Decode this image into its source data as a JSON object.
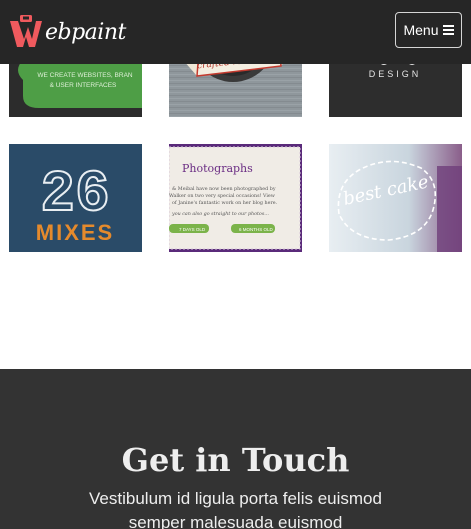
{
  "brand": {
    "logo_text": "ebpaint",
    "accent": "#f05a5e"
  },
  "header": {
    "menu_label": "Menu",
    "menu_icon": "bars-icon",
    "background": "#262626"
  },
  "portfolio": {
    "tiles": [
      {
        "id": "tile-1",
        "caption": "WE CREATE WEBSITES, BRAN",
        "caption2": "& USER INTERFACES",
        "bg": "#2c2c2c",
        "accent": "#4e9e46"
      },
      {
        "id": "tile-2",
        "caption": "crafted restaurant",
        "bg": "#8f979c"
      },
      {
        "id": "tile-3",
        "caption": "DESIGN",
        "bg": "#2d2d2d"
      },
      {
        "id": "tile-4",
        "caption": "26",
        "caption2": "MIXES",
        "bg": "#2a4b68",
        "accent": "#e58a2c"
      },
      {
        "id": "tile-5",
        "title": "Photographs",
        "body1": "& Meibal have now been photographed by",
        "body2": "Walker on two very special occasions! View",
        "body3": "of Janine's fantastic work on her blog here.",
        "body4": "you can also go straight to our photos...",
        "button1": "7 DAYS OLD",
        "button2": "6 MONTHS OLD",
        "bg": "#5a2a7a"
      },
      {
        "id": "tile-6",
        "caption": "best cake",
        "bg": "#dde8ee"
      }
    ]
  },
  "contact": {
    "title": "Get in Touch",
    "text": "Vestibulum id ligula porta felis euismod semper malesuada euismod",
    "background": "#333333"
  }
}
